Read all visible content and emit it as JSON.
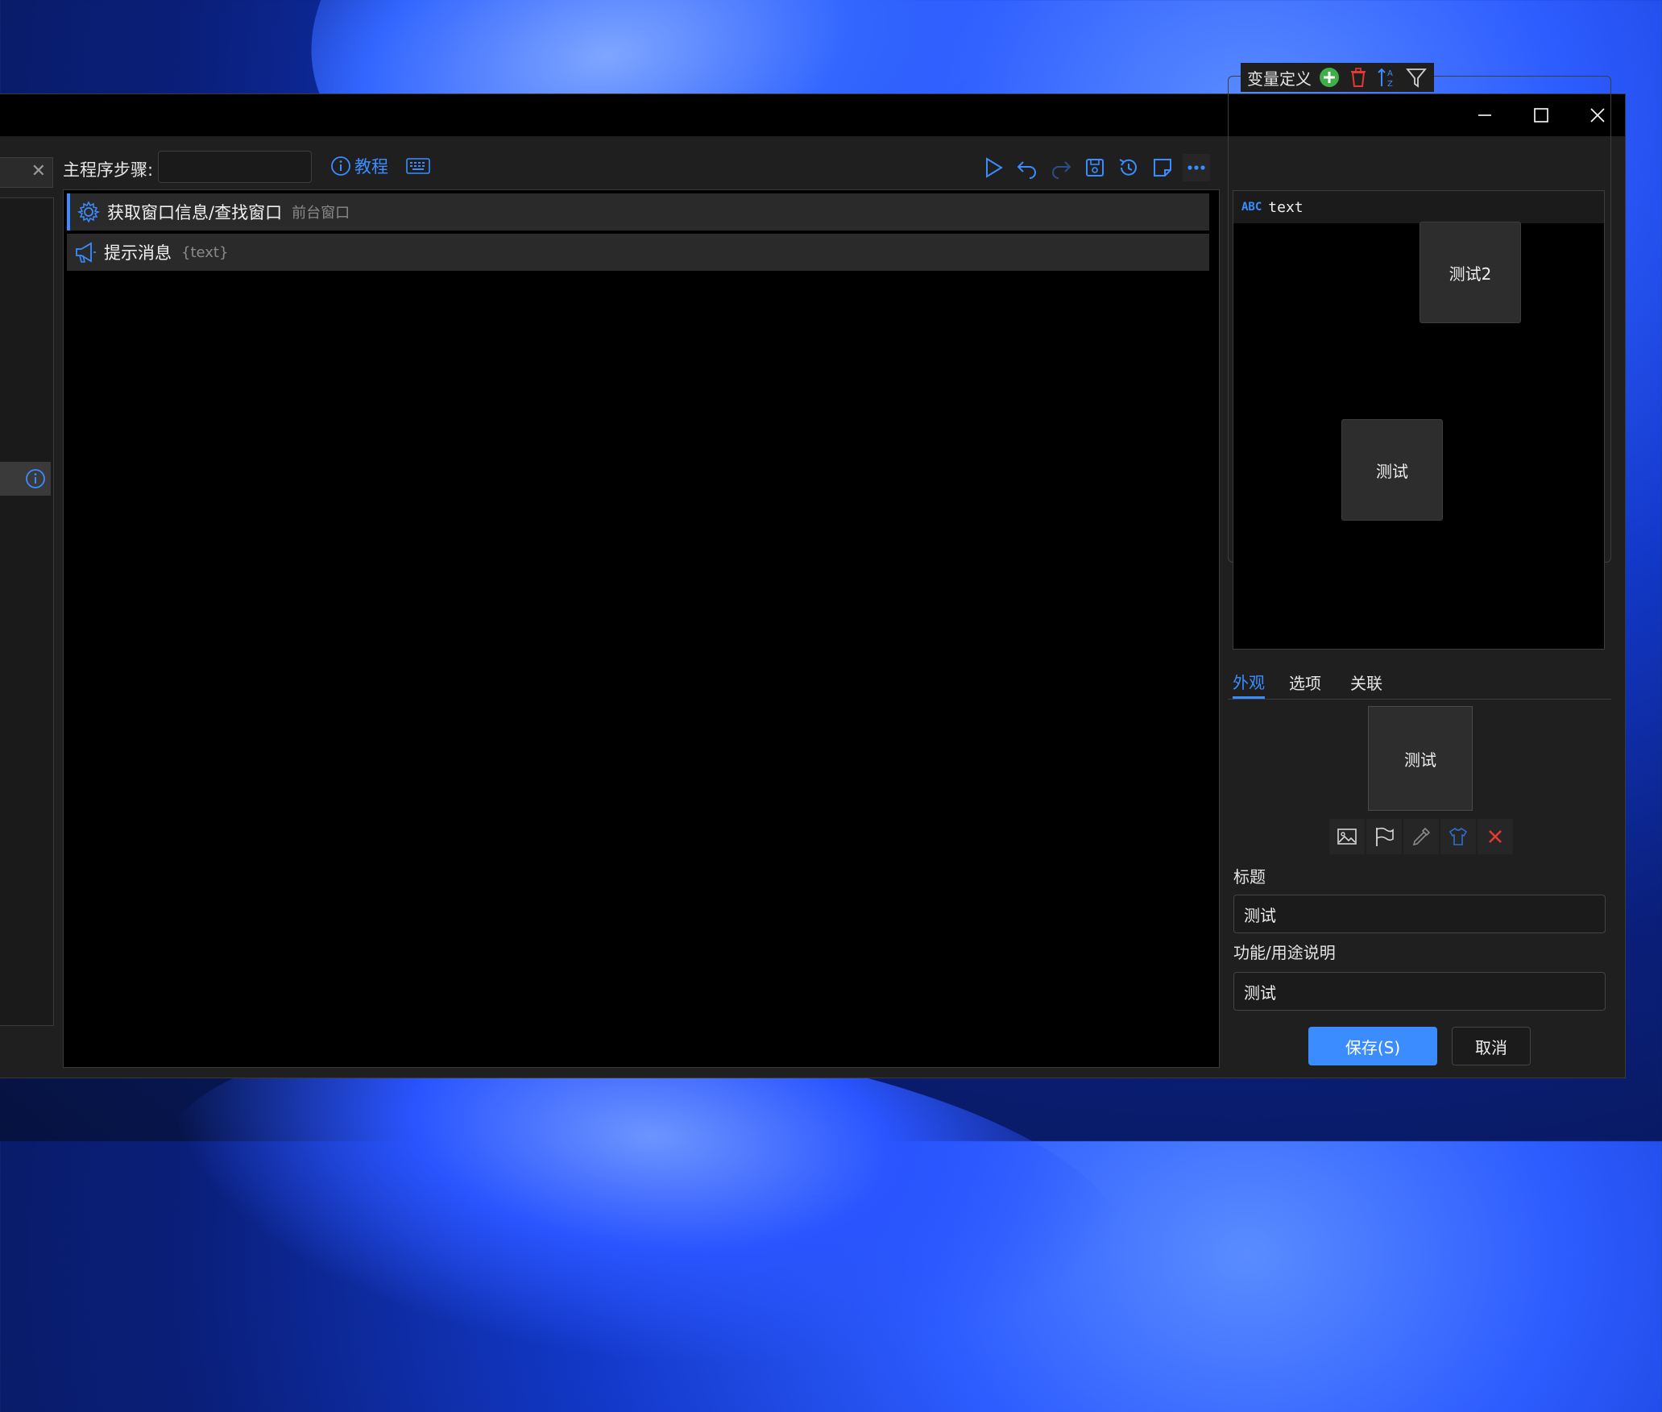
{
  "window": {
    "minimize_icon": "minimize-icon",
    "maximize_icon": "maximize-icon",
    "close_icon": "close-icon"
  },
  "toolbar": {
    "steps_label": "主程序步骤:",
    "steps_value": "",
    "tutorial_label": "教程",
    "icons": [
      "play-icon",
      "undo-icon",
      "redo-icon",
      "save-icon",
      "history-icon",
      "note-icon",
      "more-icon"
    ]
  },
  "steps": [
    {
      "title": "获取窗口信息/查找窗口",
      "subtitle": "前台窗口",
      "icon": "gear-icon"
    },
    {
      "title": "提示消息",
      "subtitle": "{text}",
      "icon": "megaphone-icon"
    }
  ],
  "variables": {
    "header": "变量定义",
    "items": [
      {
        "type_badge": "ABC",
        "name": "text"
      }
    ],
    "floating_tiles": [
      "测试2",
      "测试"
    ]
  },
  "tabs": [
    {
      "label": "外观",
      "active": true
    },
    {
      "label": "选项",
      "active": false
    },
    {
      "label": "关联",
      "active": false
    }
  ],
  "appearance": {
    "preview_text": "测试",
    "icons": [
      "image-icon",
      "flag-icon",
      "eyedropper-icon",
      "shirt-icon",
      "delete-icon"
    ]
  },
  "form": {
    "title_label": "标题",
    "title_value": "测试",
    "desc_label": "功能/用途说明",
    "desc_value": "测试"
  },
  "buttons": {
    "save": "保存(S)",
    "cancel": "取消"
  },
  "colors": {
    "accent": "#3b8dff",
    "add_green": "#3fae4a",
    "delete_red": "#e53935"
  }
}
